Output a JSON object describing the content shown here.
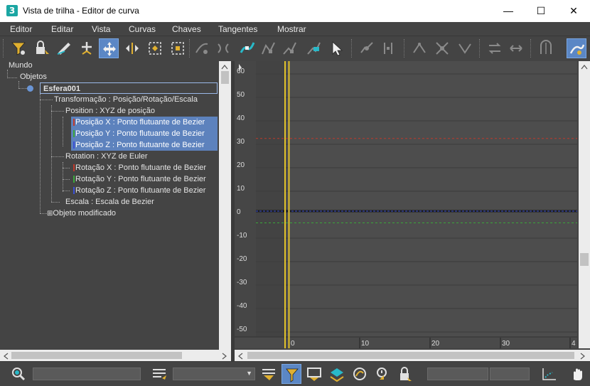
{
  "window": {
    "app_icon": "3",
    "title": "Vista de trilha - Editor de curva",
    "minimize": "—",
    "maximize": "☐",
    "close": "✕"
  },
  "menu": [
    "Editor",
    "Editar",
    "Vista",
    "Curvas",
    "Chaves",
    "Tangentes",
    "Mostrar"
  ],
  "toolbar_icons": [
    "filter-icon",
    "lock-selection-icon",
    "draw-curves-icon",
    "add-keys-icon",
    "move-keys-icon",
    "slide-keys-icon",
    "scale-keys-icon",
    "scale-values-icon",
    "ease-curve-icon",
    "multiplier-curve-icon",
    "set-tangents-auto-icon",
    "set-tangents-custom-icon",
    "set-tangents-fast-icon",
    "set-tangents-slow-icon",
    "select-cursor-icon",
    "break-tangents-icon",
    "unify-tangents-icon",
    "lock-tangents-icon",
    "show-tangents-icon",
    "snap-frames-icon",
    "parameter-out-of-range-icon",
    "swap-icon",
    "track-view-utilities-icon",
    "show-all-tangents-icon"
  ],
  "tree": {
    "world": "Mundo",
    "objects": "Objetos",
    "object_name": "Esfera001",
    "transform": "Transformação : Posição/Rotação/Escala",
    "position": "Position : XYZ de posição",
    "pos_x": "Posição X : Ponto flutuante de Bezier",
    "pos_y": "Posição Y : Ponto flutuante de Bezier",
    "pos_z": "Posição Z : Ponto flutuante de Bezier",
    "rotation": "Rotation : XYZ de Euler",
    "rot_x": "Rotação X : Ponto flutuante de Bezier",
    "rot_y": "Rotação Y : Ponto flutuante de Bezier",
    "rot_z": "Rotação Z : Ponto flutuante de Bezier",
    "scale": "Escala : Escala de Bezier",
    "modified": "Objeto modificado",
    "expand_symbol": "⊞"
  },
  "graph": {
    "y_ticks": [
      "60",
      "50",
      "40",
      "30",
      "20",
      "10",
      "0",
      "-10",
      "-20",
      "-30",
      "-40",
      "-50"
    ],
    "x_ticks": [
      "0",
      "10",
      "20",
      "30",
      "4"
    ],
    "curve_colors": {
      "x": "#c0392b",
      "y": "#3aa63a",
      "z": "#3b50d6"
    },
    "curve_values": {
      "x": 31,
      "y": -5,
      "z": 0
    },
    "current_frame": 0,
    "time_marker_color": "#e2c32a"
  },
  "colors": {
    "selection": "#5d82bd",
    "active_button": "#5b87c5",
    "background": "#444444"
  },
  "statusbar_icons": [
    "zoom-icon",
    "list-icon",
    "filter-selected-icon",
    "show-selected-keys-icon",
    "show-keyable-icon",
    "show-tangents-filter-icon",
    "isolate-curve-icon",
    "lock-keys-icon",
    "view-all-icon",
    "pan-hand-icon"
  ]
}
